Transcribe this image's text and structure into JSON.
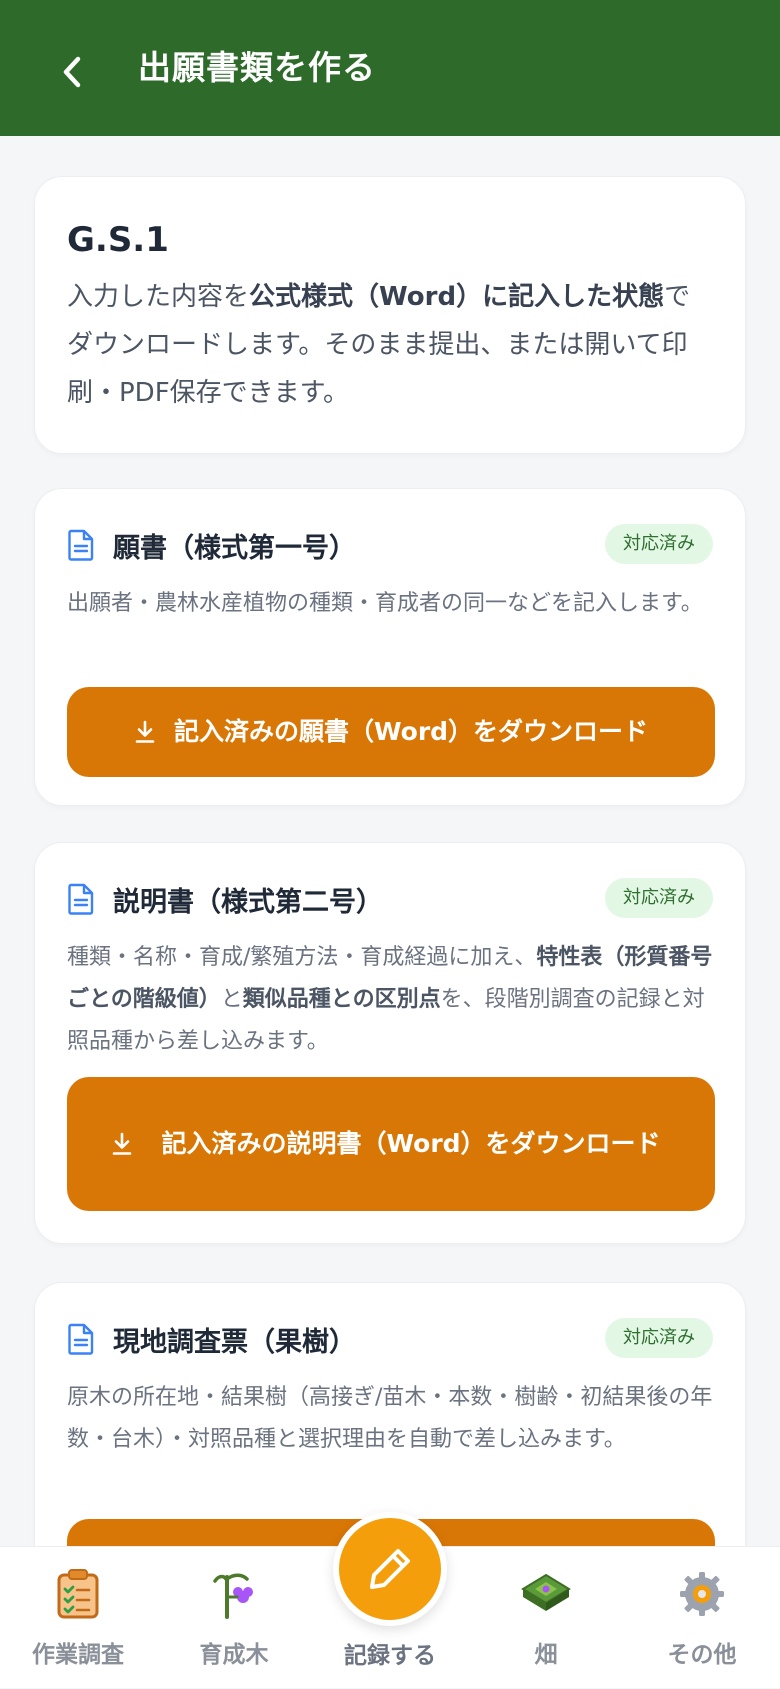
{
  "header": {
    "title": "出願書類を作る"
  },
  "intro": {
    "title": "G.S.1",
    "desc_1": "入力した内容を",
    "desc_bold": "公式様式（Word）に記入した状態",
    "desc_2": "でダウンロードします。そのまま提出、または開いて印刷・PDF保存できます。"
  },
  "documents": [
    {
      "title": "願書（様式第一号）",
      "badge": "対応済み",
      "desc": "出願者・農林水産植物の種類・育成者の同一などを記入します。",
      "button": "記入済みの願書（Word）をダウンロード"
    },
    {
      "title": "説明書（様式第二号）",
      "badge": "対応済み",
      "desc_1": "種類・名称・育成/繁殖方法・育成経過に加え、",
      "desc_bold_1": "特性表（形質番号ごとの階級値）",
      "desc_2": "と",
      "desc_bold_2": "類似品種との区別点",
      "desc_3": "を、段階別調査の記録と対照品種から差し込みます。",
      "button": "記入済みの説明書（Word）をダウンロード"
    },
    {
      "title": "現地調査票（果樹）",
      "badge": "対応済み",
      "desc": "原木の所在地・結果樹（高接ぎ/苗木・本数・樹齢・初結果後の年数・台木）・対照品種と選択理由を自動で差し込みます。",
      "button": ""
    }
  ],
  "bottom_nav": {
    "items": [
      {
        "label": "作業調査",
        "icon": "clipboard-checklist-icon"
      },
      {
        "label": "育成木",
        "icon": "sapling-icon"
      },
      {
        "label": "記録する",
        "icon": "pencil-icon"
      },
      {
        "label": "畑",
        "icon": "field-plot-icon"
      },
      {
        "label": "その他",
        "icon": "gear-icon"
      }
    ]
  },
  "colors": {
    "header_bg": "#2e6b2a",
    "button_bg": "#d97706",
    "badge_bg": "#e3f7e5",
    "fab_bg": "#f59e0b"
  }
}
